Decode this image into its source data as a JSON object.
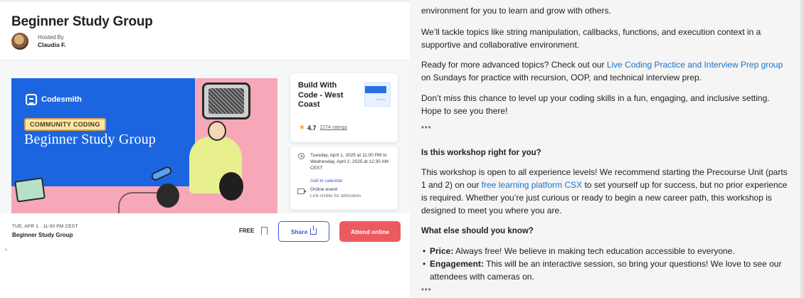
{
  "event": {
    "title": "Beginner Study Group",
    "hosted_by_label": "Hosted By",
    "host_name": "Claudia F."
  },
  "hero": {
    "brand": "Codesmith",
    "badge": "COMMUNITY CODING",
    "title": "Beginner Study Group"
  },
  "group_card": {
    "name": "Build With Code - West Coast",
    "rating": "4.7",
    "rating_count": "2274 ratings"
  },
  "info_card": {
    "date_text": "Tuesday, April 1, 2025 at 11:00 PM to Wednesday, April 2, 2025 at 12:30 AM CEST",
    "add_to_calendar": "Add to calendar",
    "online_title": "Online event",
    "online_subtitle": "Link visible for attendees"
  },
  "bottom_bar": {
    "date": "TUE, APR 1 · 11:00 PM CEST",
    "name": "Beginner Study Group",
    "price": "FREE",
    "share_label": "Share",
    "attend_label": "Attend online"
  },
  "description": {
    "p0_line": "environment for you to learn and grow with others.",
    "p1": "We’ll tackle topics like string manipulation, callbacks, functions, and execution context in a supportive and collaborative environment.",
    "p2_before": "Ready for more advanced topics? Check out our ",
    "p2_link": "Live Coding Practice and Interview Prep group",
    "p2_after": " on Sundays for practice with recursion, OOP, and technical interview prep.",
    "p3": "Don’t miss this chance to level up your coding skills in a fun, engaging, and inclusive setting. Hope to see you there!",
    "sep1": "***",
    "h1": "Is this workshop right for you?",
    "p4_before": "This workshop is open to all experience levels! We recommend starting the Precourse Unit (parts 1 and 2) on our ",
    "p4_link": "free learning platform CSX",
    "p4_after": " to set yourself up for success, but no prior experience is required. Whether you’re just curious or ready to begin a new career path, this workshop is designed to meet you where you are.",
    "h2": "What else should you know?",
    "b1_label": "Price:",
    "b1_text": " Always free! We believe in making tech education accessible to everyone.",
    "b2_label": "Engagement:",
    "b2_text": " This will be an interactive session, so bring your questions! We love to see our attendees with cameras on.",
    "sep2": "***"
  },
  "colors": {
    "accent_blue": "#3659e3",
    "attend_red": "#eb5a5f",
    "link_blue": "#1a73c9",
    "hero_blue": "#1b66e0",
    "hero_pink": "#f7a8b8"
  }
}
